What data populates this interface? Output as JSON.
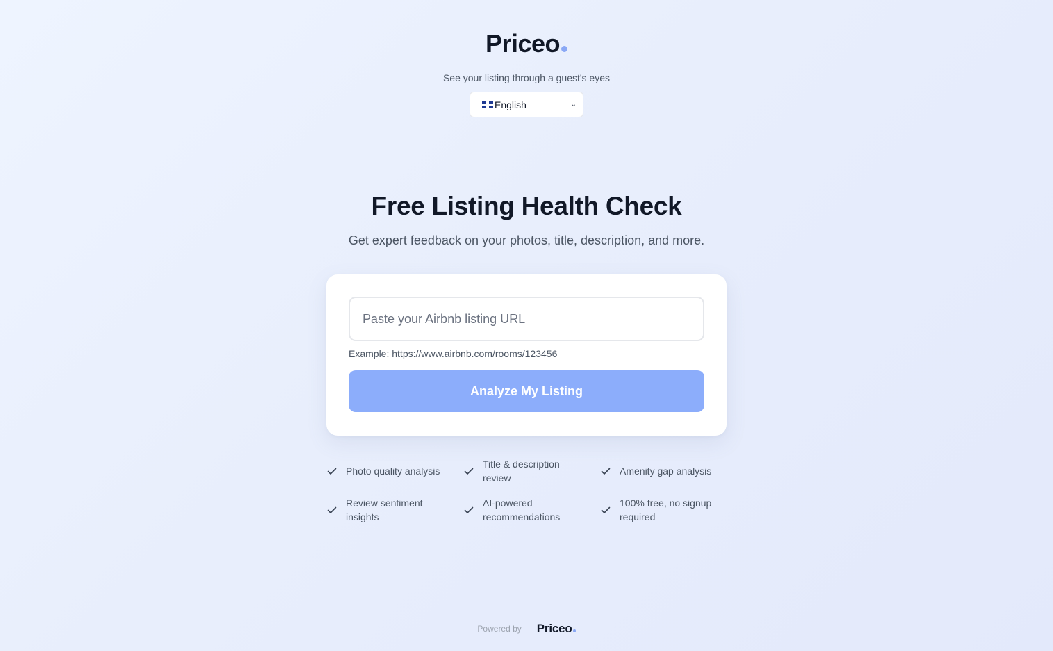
{
  "brand": {
    "name": "Priceo",
    "accent": "#8aa8f5"
  },
  "header": {
    "tagline": "See your listing through a guest's eyes",
    "language": {
      "selected": "English",
      "flag_icon": "uk-flag-icon"
    }
  },
  "hero": {
    "title": "Free Listing Health Check",
    "subtitle": "Get expert feedback on your photos, title, description, and more."
  },
  "form": {
    "url_placeholder": "Paste your Airbnb listing URL",
    "url_value": "",
    "example": "Example: https://www.airbnb.com/rooms/123456",
    "button_label": "Analyze My Listing",
    "button_color": "#8cadfb"
  },
  "features": [
    "Photo quality analysis",
    "Title & description review",
    "Amenity gap analysis",
    "Review sentiment insights",
    "AI-powered recommendations",
    "100% free, no signup required"
  ],
  "footer": {
    "powered_by": "Powered by",
    "logo": "Priceo"
  }
}
